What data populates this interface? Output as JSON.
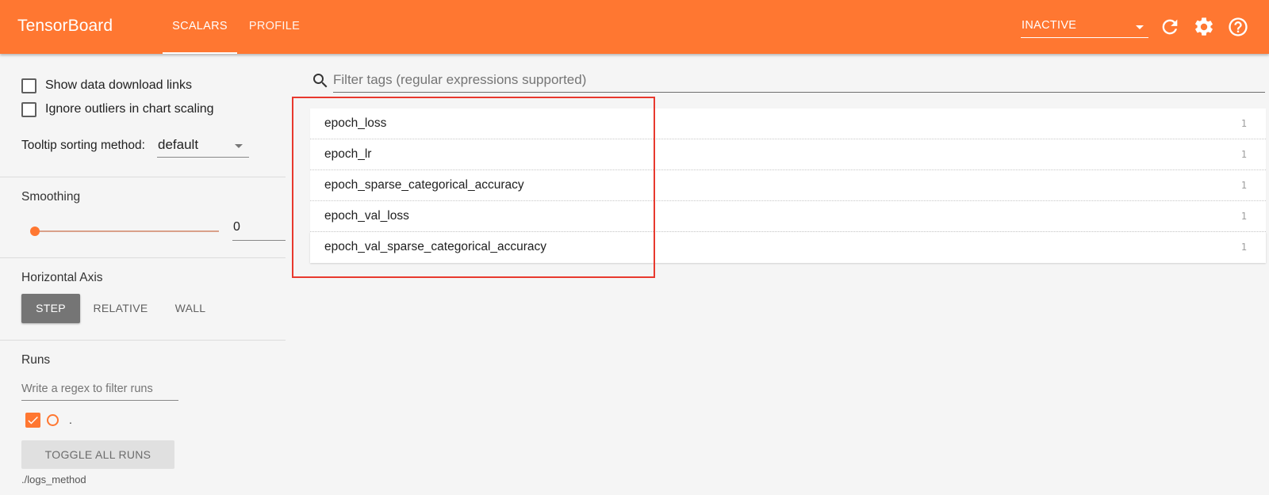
{
  "app": {
    "title": "TensorBoard"
  },
  "header": {
    "tabs": [
      {
        "label": "SCALARS",
        "active": true
      },
      {
        "label": "PROFILE",
        "active": false
      }
    ],
    "status_select": "INACTIVE",
    "icons": [
      "reload-icon",
      "gear-icon",
      "help-icon"
    ]
  },
  "sidebar": {
    "show_download_links": {
      "label": "Show data download links",
      "checked": false
    },
    "ignore_outliers": {
      "label": "Ignore outliers in chart scaling",
      "checked": false
    },
    "tooltip_sort": {
      "label": "Tooltip sorting method:",
      "value": "default"
    },
    "smoothing": {
      "title": "Smoothing",
      "value": "0",
      "slider_fraction": 0
    },
    "horizontal_axis": {
      "title": "Horizontal Axis",
      "options": [
        {
          "label": "STEP",
          "active": true
        },
        {
          "label": "RELATIVE",
          "active": false
        },
        {
          "label": "WALL",
          "active": false
        }
      ]
    },
    "runs": {
      "title": "Runs",
      "filter_placeholder": "Write a regex to filter runs",
      "items": [
        {
          "name": ".",
          "checked": true
        }
      ],
      "toggle_label": "TOGGLE ALL RUNS",
      "logdir": "./logs_method"
    }
  },
  "main": {
    "filter_placeholder": "Filter tags (regular expressions supported)",
    "tags": [
      {
        "name": "epoch_loss",
        "count": "1"
      },
      {
        "name": "epoch_lr",
        "count": "1"
      },
      {
        "name": "epoch_sparse_categorical_accuracy",
        "count": "1"
      },
      {
        "name": "epoch_val_loss",
        "count": "1"
      },
      {
        "name": "epoch_val_sparse_categorical_accuracy",
        "count": "1"
      }
    ]
  },
  "colors": {
    "brand": "#ff7731",
    "highlight": "#e8392e",
    "axis_active": "#757575"
  }
}
